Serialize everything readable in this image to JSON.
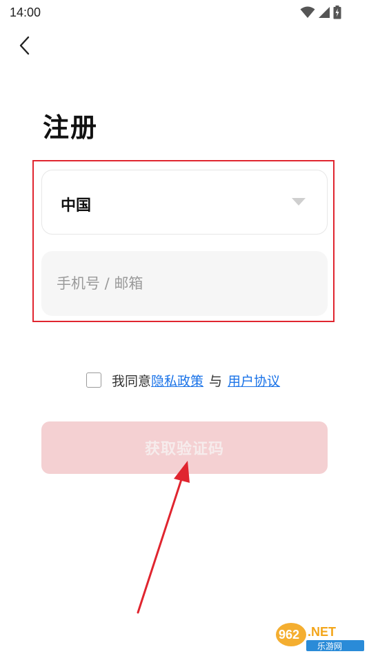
{
  "status_bar": {
    "time": "14:00",
    "icons": [
      "wifi-icon",
      "cellular-signal-icon",
      "battery-charging-icon"
    ]
  },
  "back_button": {
    "icon": "chevron-left-icon"
  },
  "page": {
    "title": "注册"
  },
  "form": {
    "country": {
      "value": "中国",
      "icon": "caret-down-icon"
    },
    "account": {
      "value": "",
      "placeholder": "手机号 / 邮箱"
    },
    "agreement": {
      "prefix": "我同意",
      "privacy_link": "隐私政策",
      "and": "与",
      "user_link": "用户协议"
    },
    "submit_label": "获取验证码"
  },
  "annotation": {
    "highlight_color": "#e0252f"
  },
  "watermark": {
    "brand": "962.NET",
    "subtitle": "乐游网"
  },
  "colors": {
    "accent_disabled": "#f4d0d2",
    "link": "#1a73e8",
    "input_bg": "#f6f6f6"
  }
}
